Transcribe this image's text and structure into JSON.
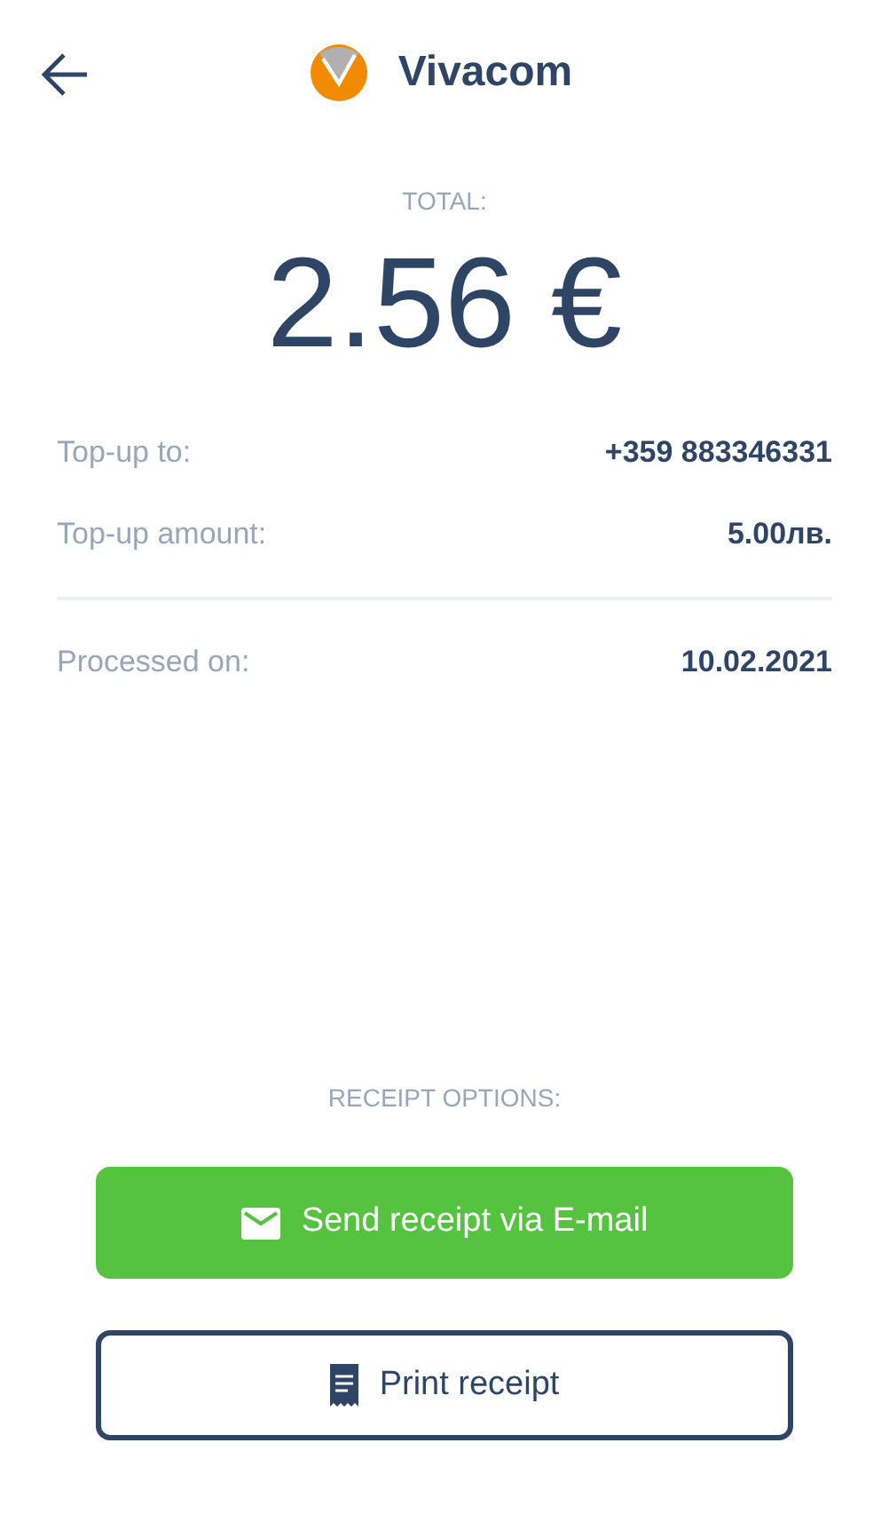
{
  "header": {
    "title": "Vivacom"
  },
  "total": {
    "label": "TOTAL:",
    "amount": "2.56 €"
  },
  "summary_rows": [
    {
      "label": "Top-up to:",
      "value": "+359 883346331"
    },
    {
      "label": "Top-up amount:",
      "value": "5.00лв."
    }
  ],
  "processing_rows": [
    {
      "label": "Processed on:",
      "value": "10.02.2021"
    }
  ],
  "receipt_options": {
    "heading": "RECEIPT OPTIONS:",
    "buttons": [
      {
        "label": "Send receipt via E-mail",
        "kind": "email"
      },
      {
        "label": "Print receipt",
        "kind": "print"
      }
    ]
  }
}
